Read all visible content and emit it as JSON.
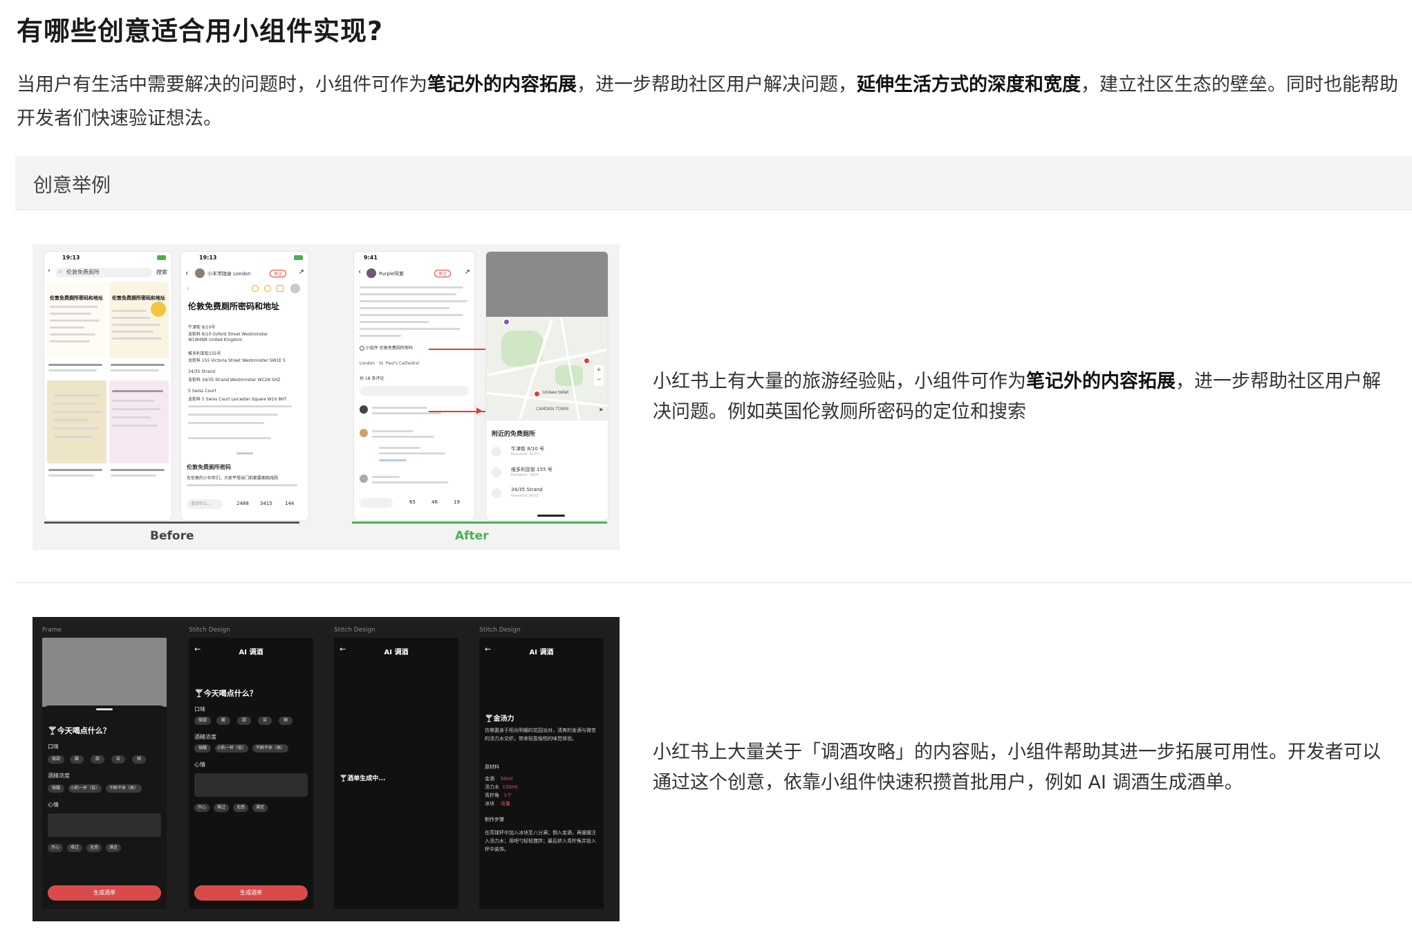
{
  "title": "有哪些创意适合用小组件实现?",
  "intro": {
    "p1": "当用户有生活中需要解决的问题时，小组件可作为",
    "b1": "笔记外的内容拓展",
    "p2": "，进一步帮助社区用户解决问题，",
    "b2": "延伸生活方式的深度和宽度",
    "p3": "，建立社区生态的壁垒。同时也能帮助开发者们快速验证想法。"
  },
  "table": {
    "header": "创意举例"
  },
  "example1": {
    "text_a": "小红书上有大量的旅游经验贴，小组件可作为",
    "text_b": "笔记外的内容拓展",
    "text_c": "，进一步帮助社区用户解决问题。例如英国伦敦厕所密码的定位和搜索",
    "before_label": "Before",
    "after_label": "After",
    "colors": {
      "before_bar": "#555555",
      "after_bar": "#4caf50",
      "after_label": "#4caf50"
    },
    "phone1": {
      "time": "19:13",
      "search": "伦敦免费厕所",
      "search_btn": "搜索",
      "card_title": "伦敦免费厕所密码和地址",
      "card2_title": "伦敦免费厕所密码和地址"
    },
    "phone2": {
      "time": "19:13",
      "author": "小羊学随身 London",
      "follow": "关注",
      "title": "伦敦免费厕所密码和地址",
      "items": [
        "牛津街 8/10号",
        "龙街科 8/10 Oxford Street Westminster",
        "W1W4NR United Kingdom",
        "推多利亚街155号",
        "龙街科 155 Victoria Street Westminster SW1E 5",
        "34/35 Strand",
        "龙街科 34/35 Strand Westminster WC2N 5HZ",
        "5 Swiss Court",
        "龙街科 5 Swiss Court Leicester Square W1V 8HT"
      ],
      "section": "伦敦免费厕所密码",
      "body": "在伦敦的小伙伴们，大家平常出门前都要面临找厕",
      "comment_placeholder": "说点什么...",
      "likes": "2488",
      "stars": "3415",
      "comments": "144"
    },
    "phone3": {
      "time": "9:41",
      "author": "Purple阿紫",
      "follow": "关注",
      "widget": "小组件 伦敦免费厕所密码",
      "location": "London · St. Paul's Cathedral",
      "comments_head": "共 18 条评论",
      "likes": "65",
      "stars": "46",
      "comments": "19"
    },
    "map": {
      "label": "Unisex toilet",
      "area": "CAMDEN TOWN",
      "nearby_title": "附近的免费厕所",
      "places": [
        {
          "name": "牛津街 8/10 号",
          "code": "Password: 9C0% "
        },
        {
          "name": "维多利亚街 155 号",
          "code": "Password: 18C4"
        },
        {
          "name": "34/35 Strand",
          "code": "Password: 9C0Z"
        }
      ]
    }
  },
  "example2": {
    "text": "小红书上大量关于「调酒攻略」的内容贴，小组件帮助其进一步拓展可用性。开发者可以通过这个创意，依靠小组件快速积攒首批用户，例如 AI 调酒生成酒单。",
    "frames": [
      "Frame",
      "Stitch Design",
      "Stitch Design",
      "Stitch Design"
    ],
    "app_title": "AI 调酒",
    "question": "今天喝点什么？",
    "taste_label": "口味",
    "taste_chips": [
      "微甜",
      "酸",
      "甜",
      "苦",
      "辣"
    ],
    "strength_label": "酒精浓度",
    "strength_chips": [
      "微醺",
      "小酌一杯（低）",
      "不醉不休（高）"
    ],
    "mood_label": "心情",
    "mood_chips": [
      "开心",
      "难过",
      "无感",
      "满足"
    ],
    "button": "生成酒单",
    "generating": "酒单生成中...",
    "result": {
      "name": "金汤力",
      "desc": "仿佛置身于阳光明媚的花园派对，清爽的金酒与微苦的汤力水交织，带来轻盈愉悦的味觉体验。",
      "ingredients_label": "原材料",
      "ingredients": [
        {
          "name": "金酒",
          "amount": "50ml"
        },
        {
          "name": "汤力水",
          "amount": "150ml"
        },
        {
          "name": "青柠角",
          "amount": "1个"
        },
        {
          "name": "冰块",
          "amount": "适量"
        }
      ],
      "steps_label": "制作步骤",
      "steps": "在高球杯中加入冰块至八分满；倒入金酒，再缓缓注入汤力水；用吧勺轻轻搅拌；最后挤入青柠角并投入杯中装饰。"
    },
    "colors": {
      "button": "#d94b4b",
      "bg": "#1e1e1e",
      "screen": "#111111"
    }
  }
}
